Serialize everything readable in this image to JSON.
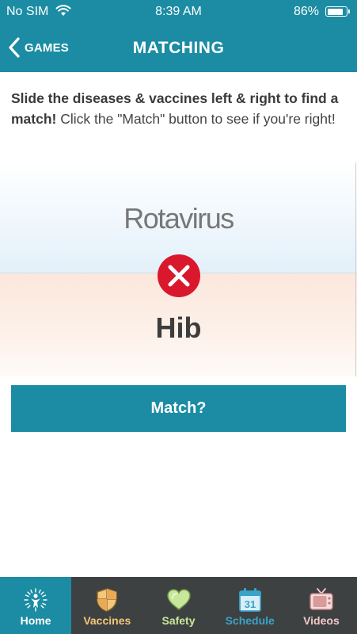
{
  "status_bar": {
    "carrier": "No SIM",
    "time": "8:39 AM",
    "battery": "86%",
    "battery_level": 0.86
  },
  "nav": {
    "back_label": "GAMES",
    "title": "MATCHING"
  },
  "instructions": {
    "bold": "Slide the diseases & vaccines left & right to find a match!",
    "normal": " Click the \"Match\" button to see if you're right!"
  },
  "game": {
    "disease": "Rotavirus",
    "vaccine": "Hib",
    "result_icon": "x-circle-icon"
  },
  "match_button": {
    "label": "Match?"
  },
  "tabs": [
    {
      "label": "Home",
      "icon": "home-icon",
      "color": "#ffffff",
      "active": true
    },
    {
      "label": "Vaccines",
      "icon": "shield-icon",
      "color": "#f4c77b",
      "active": false
    },
    {
      "label": "Safety",
      "icon": "heart-icon",
      "color": "#c7e89a",
      "active": false
    },
    {
      "label": "Schedule",
      "icon": "calendar-icon",
      "color": "#3aa3c9",
      "active": false
    },
    {
      "label": "Videos",
      "icon": "tv-icon",
      "color": "#f2c9c9",
      "active": false
    }
  ],
  "colors": {
    "primary": "#1b8ca3",
    "tabbar": "#3e4141",
    "error": "#d9182d"
  }
}
